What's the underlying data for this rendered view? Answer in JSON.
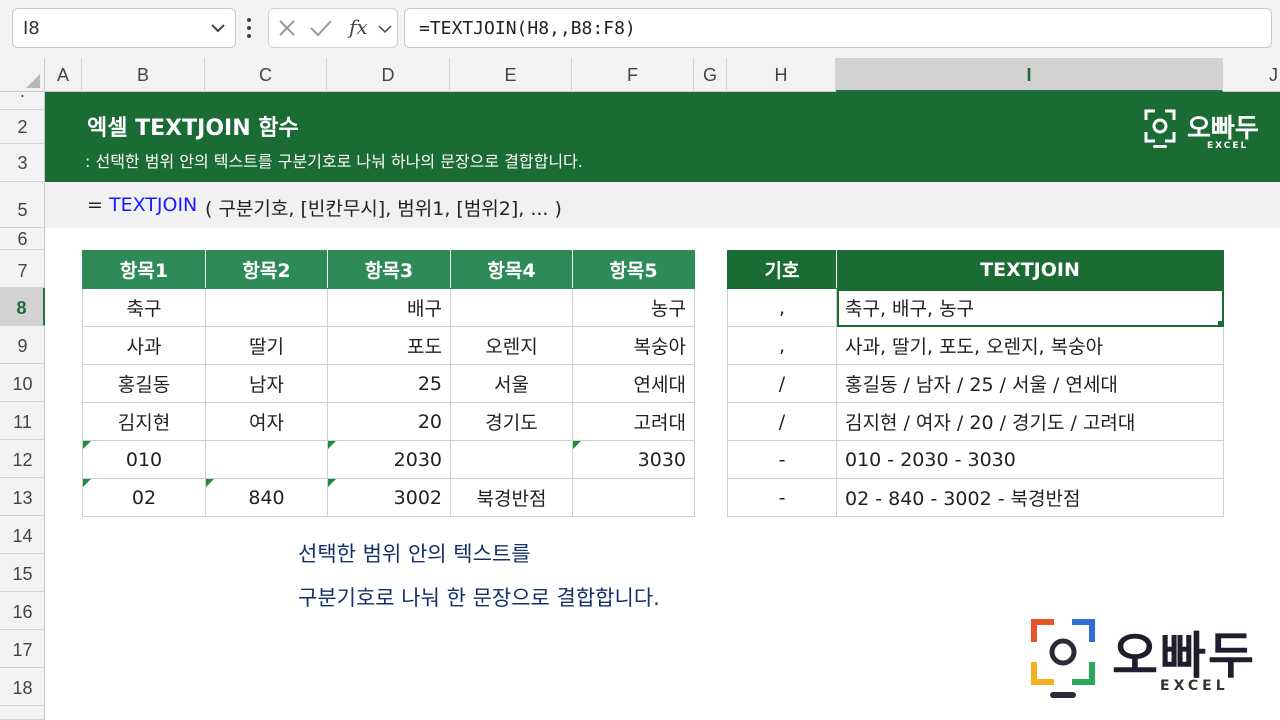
{
  "name_box": {
    "value": "I8"
  },
  "formula_bar": {
    "fx_label": "fx",
    "formula": "=TEXTJOIN(H8,,B8:F8)"
  },
  "columns": [
    "A",
    "B",
    "C",
    "D",
    "E",
    "F",
    "G",
    "H",
    "I",
    "J"
  ],
  "selected_column": "I",
  "rows": [
    "2",
    "3",
    "5",
    "6",
    "7",
    "8",
    "9",
    "10",
    "11",
    "12",
    "13",
    "14",
    "15",
    "16",
    "17",
    "18"
  ],
  "selected_row": "8",
  "banner": {
    "title": "엑셀 TEXTJOIN 함수",
    "subtitle": ": 선택한 범위 안의 텍스트를 구분기호로 나눠 하나의 문장으로 결합합니다.",
    "logo_text": "오빠두",
    "logo_sub": "EXCEL"
  },
  "syntax": {
    "eq": "=",
    "fn": "TEXTJOIN",
    "args": "( 구분기호, [빈칸무시], 범위1, [범위2], ... )"
  },
  "table_left": {
    "headers": [
      "항목1",
      "항목2",
      "항목3",
      "항목4",
      "항목5"
    ],
    "rows": [
      [
        "축구",
        "",
        "배구",
        "",
        "농구"
      ],
      [
        "사과",
        "딸기",
        "포도",
        "오렌지",
        "복숭아"
      ],
      [
        "홍길동",
        "남자",
        "25",
        "서울",
        "연세대"
      ],
      [
        "김지현",
        "여자",
        "20",
        "경기도",
        "고려대"
      ],
      [
        "010",
        "",
        "2030",
        "",
        "3030"
      ],
      [
        "02",
        "840",
        "3002",
        "북경반점",
        ""
      ]
    ]
  },
  "table_right": {
    "headers": [
      "기호",
      "TEXTJOIN"
    ],
    "rows": [
      [
        ",",
        "축구, 배구, 농구"
      ],
      [
        ",",
        "사과, 딸기, 포도, 오렌지, 복숭아"
      ],
      [
        "/",
        "홍길동 / 남자 / 25 / 서울 / 연세대"
      ],
      [
        "/",
        "김지현 / 여자 / 20 / 경기도 / 고려대"
      ],
      [
        "-",
        "010 - 2030 - 3030"
      ],
      [
        "-",
        "02 - 840 - 3002 - 북경반점"
      ]
    ]
  },
  "caption": {
    "line1": "선택한 범위 안의 텍스트를",
    "line2": "구분기호로 나눠 한 문장으로 결합합니다."
  },
  "brand": {
    "text": "오빠두",
    "sub": "EXCEL"
  }
}
